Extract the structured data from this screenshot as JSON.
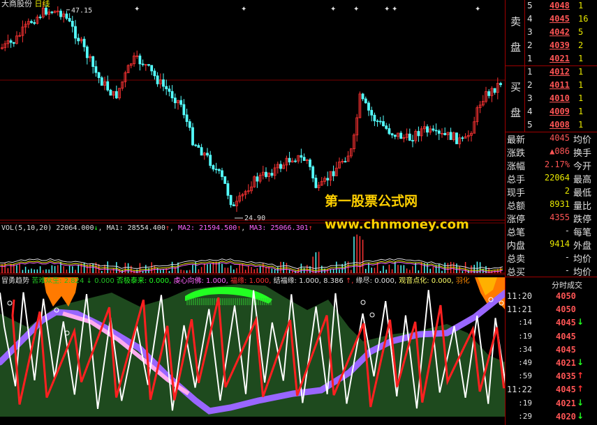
{
  "title": {
    "name": "大商股份",
    "period": "日线"
  },
  "price_labels": {
    "high": "47.15",
    "low": "24.90"
  },
  "volume_header": {
    "name": "VOL(5,10,20)",
    "vol": "22064.000",
    "vol_arrow": "↓",
    "ma1": "MA1: 28554.400",
    "ma1_arrow": "↑",
    "ma2": "MA2: 21594.500",
    "ma2_arrow": "↑",
    "ma3": "MA3: 25066.301",
    "ma3_arrow": "↑"
  },
  "indicator_header": {
    "name": "冒勇趋势",
    "items": [
      {
        "text": "苦难众生: 2.824",
        "color": "#22c022"
      },
      {
        "text": "↓",
        "color": "#22c022"
      },
      {
        "text": "0.000",
        "color": "#22c022"
      },
      {
        "text": "否极泰来: 0.000,",
        "color": "#22ff22"
      },
      {
        "text": "虔心向佛: 1.000,",
        "color": "#ff66ff"
      },
      {
        "text": "福缘: 1.000,",
        "color": "#ff3333"
      },
      {
        "text": "结福缘: 1.000, 8.386",
        "color": "#e0e0e0"
      },
      {
        "text": "↑,",
        "color": "#ff3333"
      },
      {
        "text": "缘尽: 0.000,",
        "color": "#e0e0e0"
      },
      {
        "text": "观音点化: 0.000,",
        "color": "#ffff66"
      },
      {
        "text": "羽化",
        "color": "#ff8800"
      }
    ]
  },
  "watermark": {
    "line1": "第一股票公式网",
    "line2": "www.chnmoney.com"
  },
  "order_book": {
    "sell_label": [
      "卖",
      "盘"
    ],
    "buy_label": [
      "买",
      "盘"
    ],
    "sell": [
      {
        "idx": "5",
        "price": "4048",
        "vol": "1"
      },
      {
        "idx": "4",
        "price": "4045",
        "vol": "16"
      },
      {
        "idx": "3",
        "price": "4042",
        "vol": "5"
      },
      {
        "idx": "2",
        "price": "4039",
        "vol": "2"
      },
      {
        "idx": "1",
        "price": "4021",
        "vol": "1"
      }
    ],
    "buy": [
      {
        "idx": "1",
        "price": "4012",
        "vol": "1"
      },
      {
        "idx": "2",
        "price": "4011",
        "vol": "1"
      },
      {
        "idx": "3",
        "price": "4010",
        "vol": "1"
      },
      {
        "idx": "4",
        "price": "4009",
        "vol": "1"
      },
      {
        "idx": "5",
        "price": "4008",
        "vol": "1"
      }
    ]
  },
  "quote": {
    "rows": [
      {
        "l": "最新",
        "v": "4045",
        "c": "#ff5555",
        "r": "均价",
        "rv": ""
      },
      {
        "l": "涨跌",
        "v": "▲086",
        "c": "#ff5555",
        "r": "换手",
        "rv": ""
      },
      {
        "l": "涨幅",
        "v": "2.17%",
        "c": "#ff5555",
        "r": "今开",
        "rv": ""
      },
      {
        "l": "总手",
        "v": "22064",
        "c": "#e8e800",
        "r": "最高",
        "rv": ""
      },
      {
        "l": "现手",
        "v": "2",
        "c": "#e8e800",
        "r": "最低",
        "rv": ""
      },
      {
        "l": "总额",
        "v": "8931",
        "c": "#e8e800",
        "r": "量比",
        "rv": ""
      },
      {
        "l": "涨停",
        "v": "4355",
        "c": "#ff5555",
        "r": "跌停",
        "rv": ""
      },
      {
        "l": "总笔",
        "v": "-",
        "c": "#e0e0e0",
        "r": "每笔",
        "rv": ""
      },
      {
        "l": "内盘",
        "v": "9414",
        "c": "#e8e800",
        "r": "外盘",
        "rv": ""
      },
      {
        "l": "总卖",
        "v": "-",
        "c": "#e0e0e0",
        "r": "均价",
        "rv": ""
      },
      {
        "l": "总买",
        "v": "-",
        "c": "#e0e0e0",
        "r": "均价",
        "rv": ""
      }
    ]
  },
  "ticks": {
    "title": "分时成交",
    "rows": [
      {
        "time": "11:20",
        "price": "4050",
        "arrow": ""
      },
      {
        "time": "11:21",
        "price": "4050",
        "arrow": ""
      },
      {
        "time": ":14",
        "price": "4045",
        "arrow": "↓"
      },
      {
        "time": ":19",
        "price": "4045",
        "arrow": ""
      },
      {
        "time": ":34",
        "price": "4045",
        "arrow": ""
      },
      {
        "time": ":49",
        "price": "4021",
        "arrow": "↓"
      },
      {
        "time": ":59",
        "price": "4035",
        "arrow": "↑"
      },
      {
        "time": "11:22",
        "price": "4045",
        "arrow": "↑"
      },
      {
        "time": ":19",
        "price": "4021",
        "arrow": "↓"
      },
      {
        "time": ":29",
        "price": "4020",
        "arrow": "↓"
      }
    ]
  },
  "colors": {
    "up": "#ff3333",
    "down": "#54ffff",
    "grid": "#a00000",
    "gold": "#ffd000"
  }
}
